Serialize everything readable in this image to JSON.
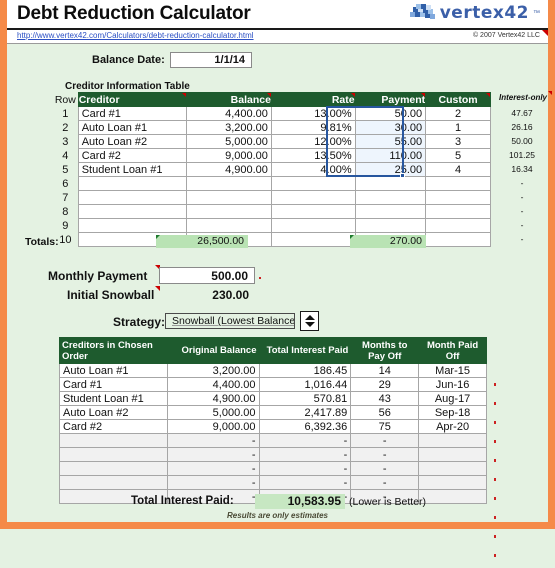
{
  "header": {
    "title": "Debt Reduction Calculator",
    "logo_text": "vertex42",
    "logo_tm": "™",
    "url": "http://www.vertex42.com/Calculators/debt-reduction-calculator.html",
    "copyright": "© 2007 Vertex42 LLC"
  },
  "balance_date": {
    "label": "Balance Date:",
    "value": "1/1/14"
  },
  "creditor_table": {
    "caption": "Creditor Information Table",
    "row_header": "Row",
    "headers": [
      "Creditor",
      "Balance",
      "Rate",
      "Payment",
      "Custom"
    ],
    "interest_only_header": "Interest-only",
    "rows": [
      {
        "num": "1",
        "creditor": "Card #1",
        "balance": "4,400.00",
        "rate": "13.00%",
        "payment": "50.00",
        "custom": "2",
        "interest_only": "47.67"
      },
      {
        "num": "2",
        "creditor": "Auto Loan #1",
        "balance": "3,200.00",
        "rate": "9.81%",
        "payment": "30.00",
        "custom": "1",
        "interest_only": "26.16"
      },
      {
        "num": "3",
        "creditor": "Auto Loan #2",
        "balance": "5,000.00",
        "rate": "12.00%",
        "payment": "55.00",
        "custom": "3",
        "interest_only": "50.00"
      },
      {
        "num": "4",
        "creditor": "Card #2",
        "balance": "9,000.00",
        "rate": "13.50%",
        "payment": "110.00",
        "custom": "5",
        "interest_only": "101.25"
      },
      {
        "num": "5",
        "creditor": "Student Loan #1",
        "balance": "4,900.00",
        "rate": "4.00%",
        "payment": "25.00",
        "custom": "4",
        "interest_only": "16.34"
      },
      {
        "num": "6",
        "creditor": "",
        "balance": "",
        "rate": "",
        "payment": "",
        "custom": "",
        "interest_only": "-"
      },
      {
        "num": "7",
        "creditor": "",
        "balance": "",
        "rate": "",
        "payment": "",
        "custom": "",
        "interest_only": "-"
      },
      {
        "num": "8",
        "creditor": "",
        "balance": "",
        "rate": "",
        "payment": "",
        "custom": "",
        "interest_only": "-"
      },
      {
        "num": "9",
        "creditor": "",
        "balance": "",
        "rate": "",
        "payment": "",
        "custom": "",
        "interest_only": "-"
      },
      {
        "num": "10",
        "creditor": "",
        "balance": "",
        "rate": "",
        "payment": "",
        "custom": "",
        "interest_only": "-"
      }
    ],
    "totals_label": "Totals:",
    "total_balance": "26,500.00",
    "total_payment": "270.00"
  },
  "inputs": {
    "monthly_payment_label": "Monthly Payment",
    "monthly_payment_value": "500.00",
    "initial_snowball_label": "Initial Snowball",
    "initial_snowball_value": "230.00",
    "strategy_label": "Strategy:",
    "strategy_value": "Snowball (Lowest Balance First)"
  },
  "results_table": {
    "headers": [
      "Creditors in Chosen Order",
      "Original Balance",
      "Total Interest Paid",
      "Months to Pay Off",
      "Month Paid Off"
    ],
    "rows": [
      {
        "name": "Auto Loan #1",
        "balance": "3,200.00",
        "interest": "186.45",
        "months": "14",
        "paid_off": "Mar-15",
        "filled": true
      },
      {
        "name": "Card #1",
        "balance": "4,400.00",
        "interest": "1,016.44",
        "months": "29",
        "paid_off": "Jun-16",
        "filled": true
      },
      {
        "name": "Student Loan #1",
        "balance": "4,900.00",
        "interest": "570.81",
        "months": "43",
        "paid_off": "Aug-17",
        "filled": true
      },
      {
        "name": "Auto Loan #2",
        "balance": "5,000.00",
        "interest": "2,417.89",
        "months": "56",
        "paid_off": "Sep-18",
        "filled": true
      },
      {
        "name": "Card #2",
        "balance": "9,000.00",
        "interest": "6,392.36",
        "months": "75",
        "paid_off": "Apr-20",
        "filled": true
      },
      {
        "name": "",
        "balance": "-",
        "interest": "-",
        "months": "-",
        "paid_off": "",
        "filled": false
      },
      {
        "name": "",
        "balance": "-",
        "interest": "-",
        "months": "-",
        "paid_off": "",
        "filled": false
      },
      {
        "name": "",
        "balance": "-",
        "interest": "-",
        "months": "-",
        "paid_off": "",
        "filled": false
      },
      {
        "name": "",
        "balance": "-",
        "interest": "-",
        "months": "-",
        "paid_off": "",
        "filled": false
      },
      {
        "name": "",
        "balance": "-",
        "interest": "-",
        "months": "-",
        "paid_off": "",
        "filled": false
      }
    ],
    "total_interest_label": "Total Interest Paid:",
    "total_interest_value": "10,583.95",
    "total_interest_note": "(Lower is Better)",
    "footer_note": "Results are only estimates"
  },
  "colors": {
    "frame": "#f58a48",
    "page_bg": "#e4f2e2",
    "header_green": "#1e5b2e",
    "total_green": "#b9e3b4",
    "link_blue": "#2a4fc4",
    "selection_blue": "#27569e",
    "logo_blue": "#3b5fa8"
  }
}
